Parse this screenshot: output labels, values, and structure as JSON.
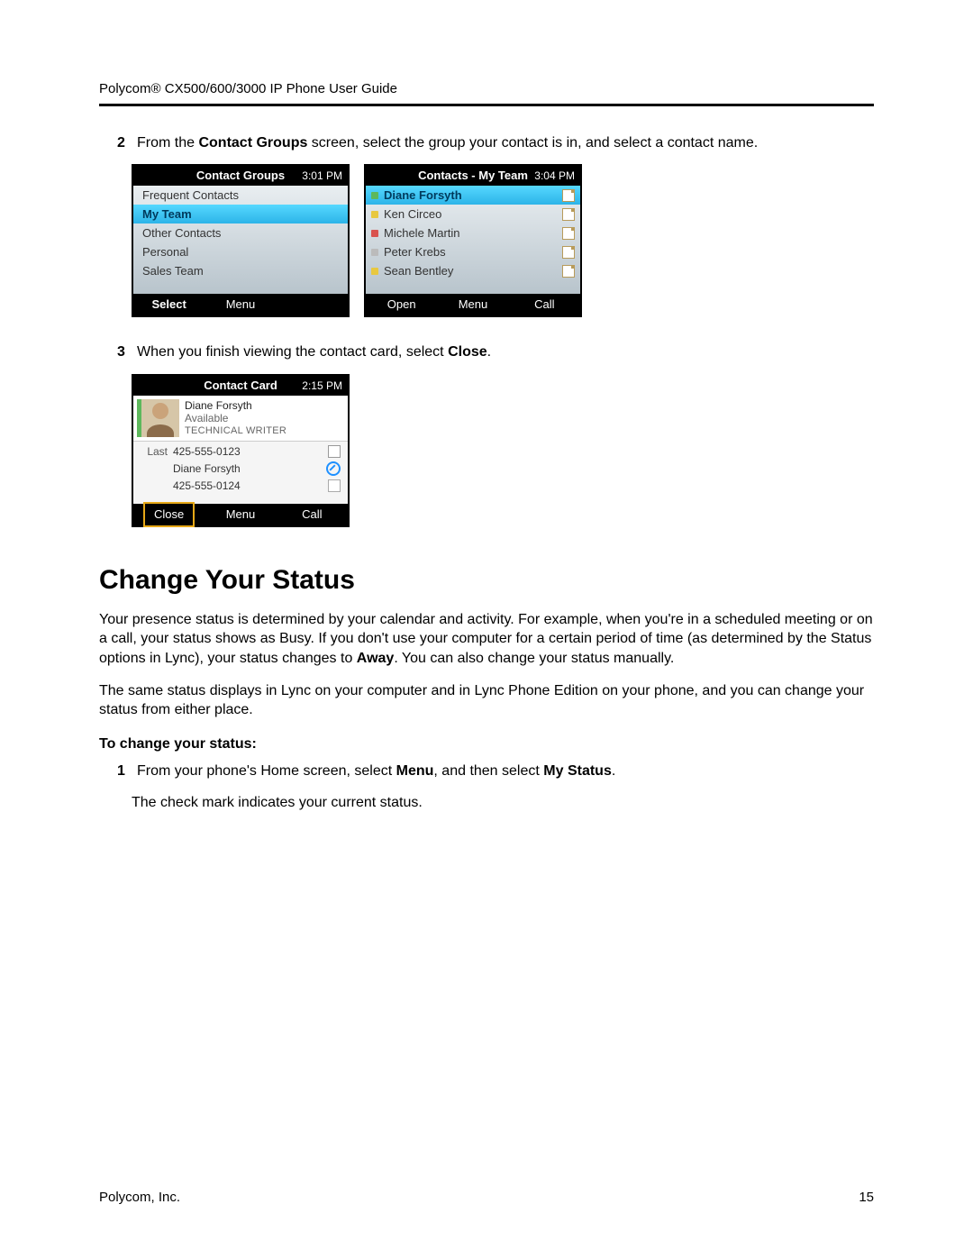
{
  "header": {
    "title": "Polycom® CX500/600/3000 IP Phone User Guide"
  },
  "step2": {
    "num": "2",
    "text_pre": "From the ",
    "text_b1": "Contact Groups",
    "text_mid": " screen, select the group your contact is in, and select a contact name."
  },
  "screen_groups": {
    "title": "Contact Groups",
    "time": "3:01 PM",
    "items": [
      {
        "label": "Frequent Contacts",
        "selected": false
      },
      {
        "label": "My Team",
        "selected": true
      },
      {
        "label": "Other Contacts",
        "selected": false
      },
      {
        "label": "Personal",
        "selected": false
      },
      {
        "label": "Sales Team",
        "selected": false
      }
    ],
    "soft_left": "Select",
    "soft_mid": "Menu"
  },
  "screen_contacts": {
    "title": "Contacts - My Team",
    "time": "3:04 PM",
    "items": [
      {
        "name": "Diane Forsyth",
        "presence": "green",
        "selected": true
      },
      {
        "name": "Ken Circeo",
        "presence": "yellow",
        "selected": false
      },
      {
        "name": "Michele Martin",
        "presence": "red",
        "selected": false
      },
      {
        "name": "Peter Krebs",
        "presence": "gray",
        "selected": false
      },
      {
        "name": "Sean Bentley",
        "presence": "yellow",
        "selected": false
      }
    ],
    "soft_left": "Open",
    "soft_mid": "Menu",
    "soft_right": "Call"
  },
  "step3": {
    "num": "3",
    "text_pre": "When you finish viewing the contact card, select ",
    "text_b1": "Close",
    "text_post": "."
  },
  "screen_card": {
    "title": "Contact Card",
    "time": "2:15 PM",
    "name": "Diane Forsyth",
    "status": "Available",
    "role": "TECHNICAL WRITER",
    "rows": [
      {
        "label": "Last",
        "value": "425-555-0123",
        "icon": "home"
      },
      {
        "label": "",
        "value": "Diane Forsyth",
        "icon": "block"
      },
      {
        "label": "",
        "value": "425-555-0124",
        "icon": "page"
      }
    ],
    "soft_left": "Close",
    "soft_mid": "Menu",
    "soft_right": "Call"
  },
  "section": {
    "heading": "Change Your Status",
    "p1_a": "Your presence status is determined by your calendar and activity. For example, when you're in a scheduled meeting or on a call, your status shows as Busy. If you don't use your computer for a certain period of time (as determined by the Status options in Lync), your status changes to ",
    "p1_b": "Away",
    "p1_c": ". You can also change your status manually.",
    "p2": "The same status displays in Lync on your computer and in Lync Phone Edition on your phone, and you can change your status from either place.",
    "sub": "To change your status:",
    "s1_num": "1",
    "s1_a": "From your phone's Home screen, select ",
    "s1_b": "Menu",
    "s1_c": ", and then select ",
    "s1_d": "My Status",
    "s1_e": ".",
    "s1_line2": "The check mark indicates your current status."
  },
  "footer": {
    "company": "Polycom, Inc.",
    "page": "15"
  }
}
